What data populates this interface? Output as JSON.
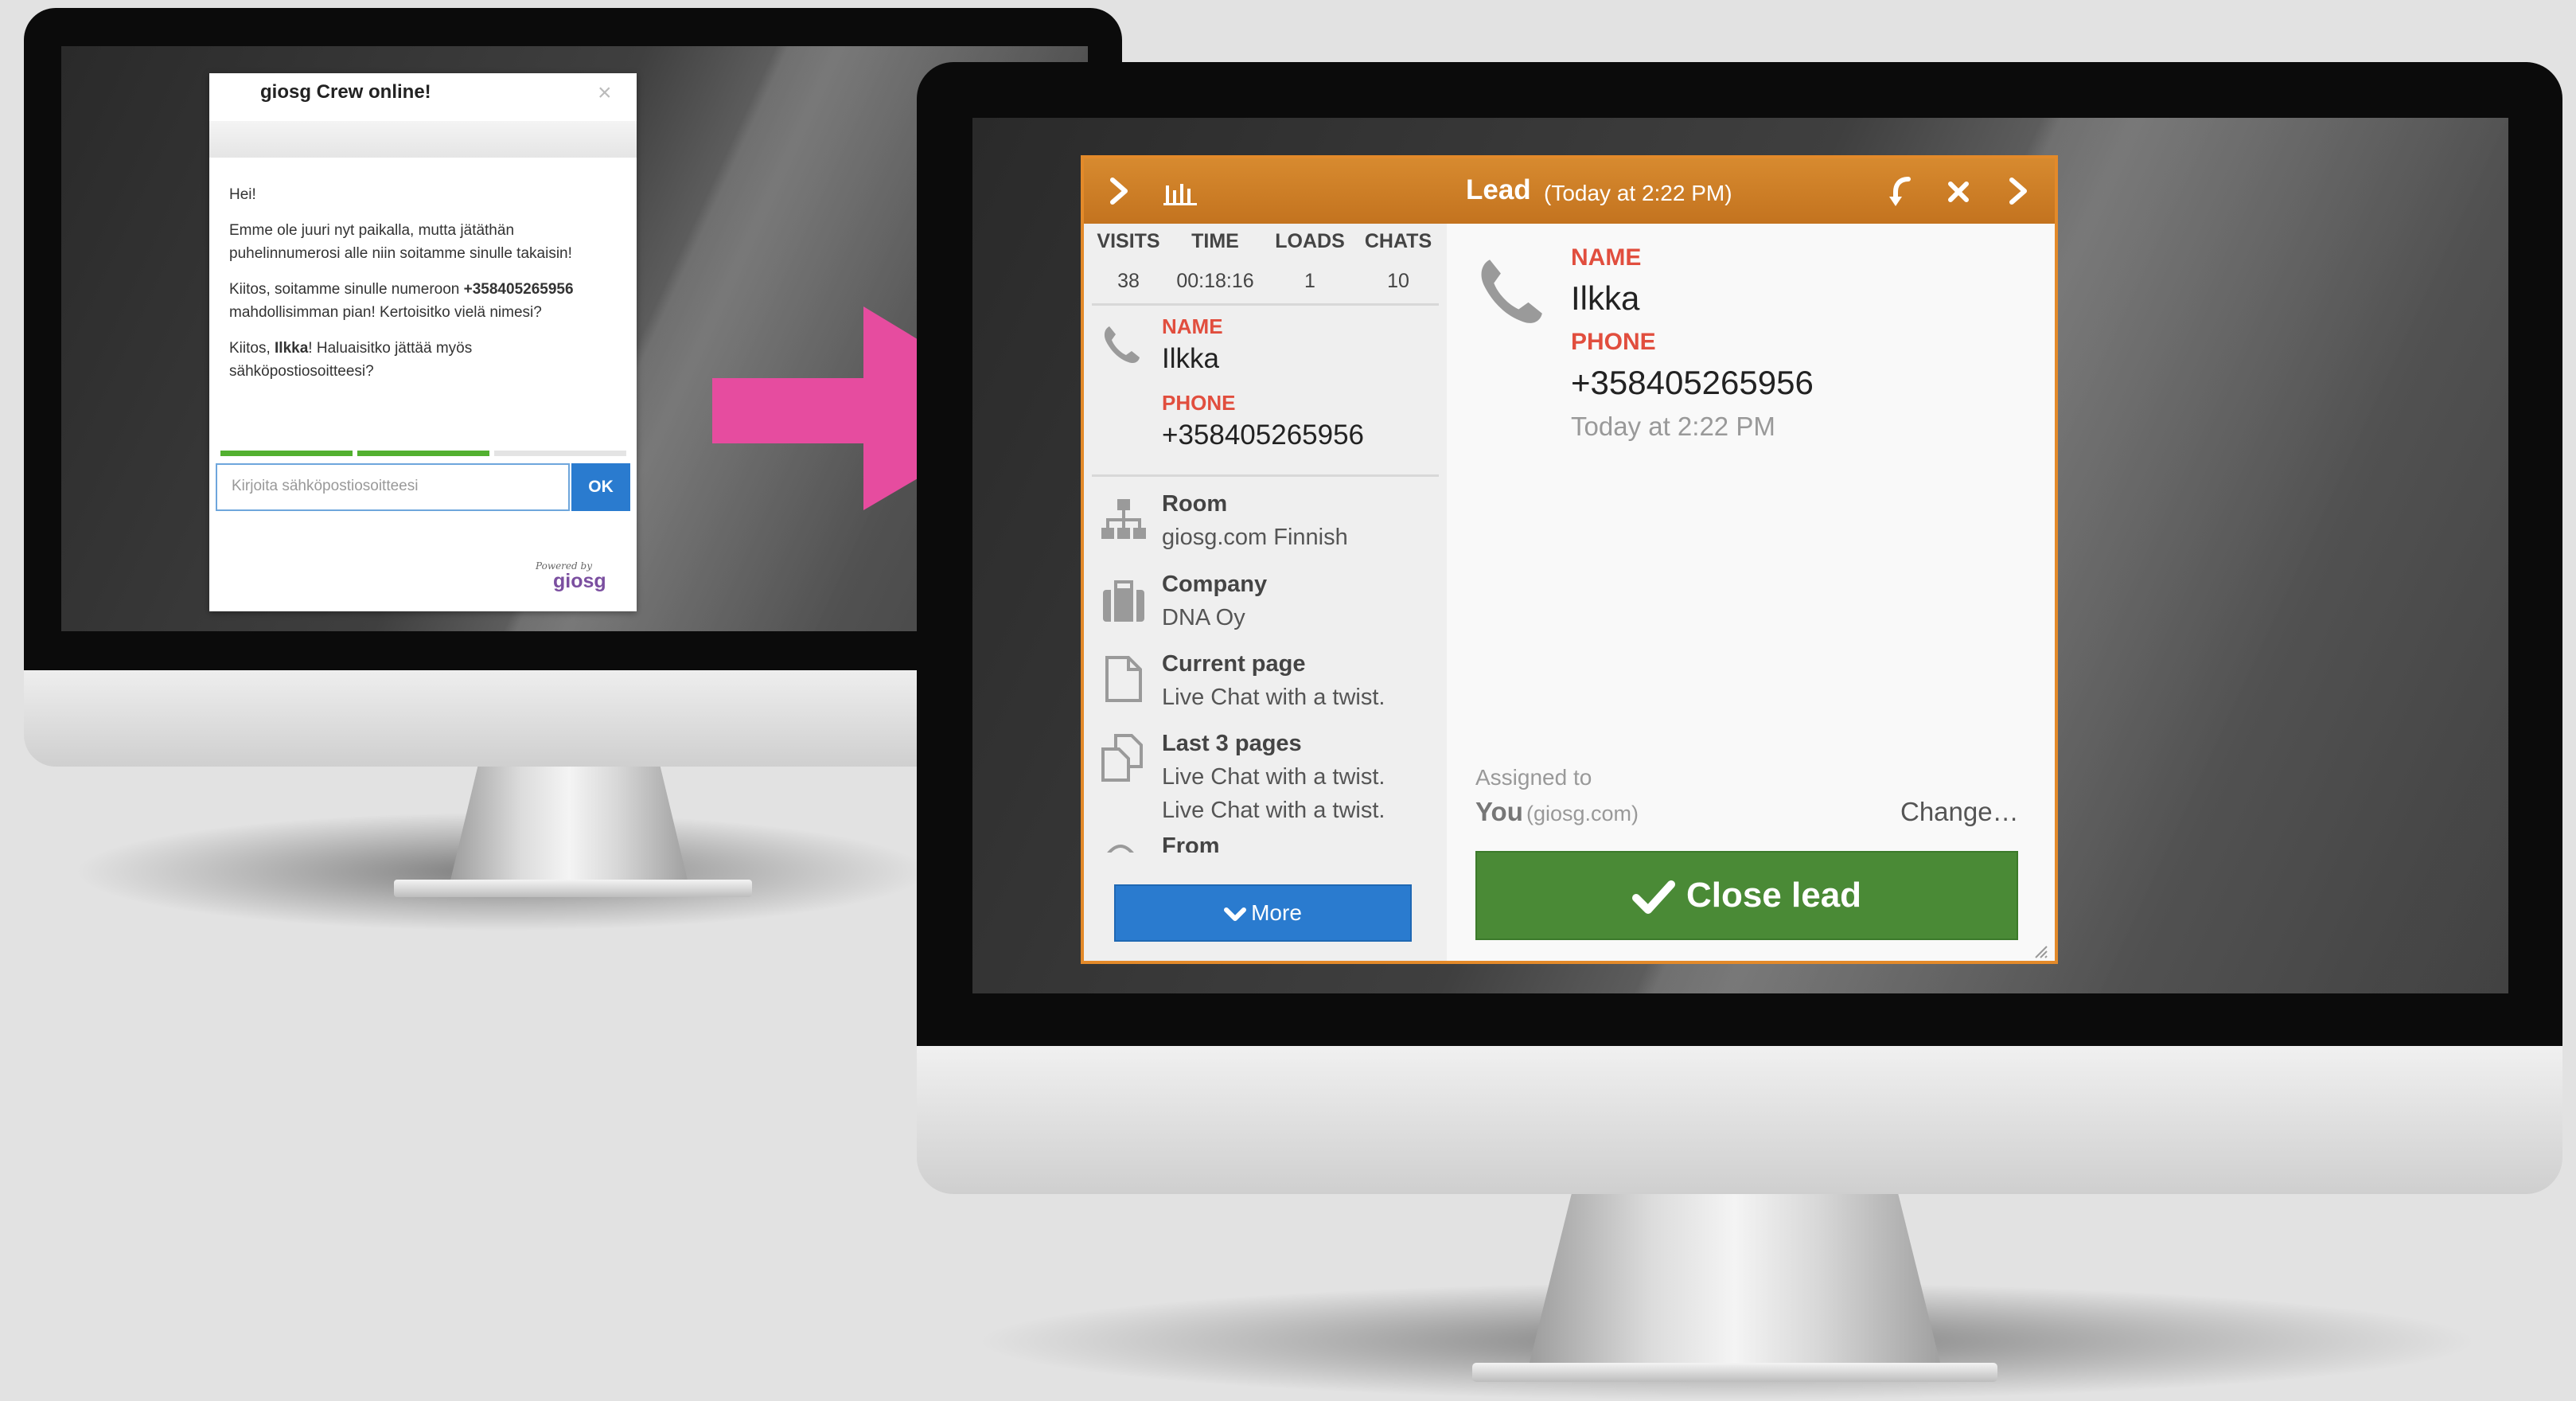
{
  "left_widget": {
    "title": "giosg Crew online!",
    "close_glyph": "×",
    "greeting": "Hei!",
    "msg1": "Emme ole juuri nyt paikalla, mutta jätäthän puhelinnumerosi alle niin soitamme sinulle takaisin!",
    "msg2_pre": "Kiitos, soitamme sinulle numeroon ",
    "msg2_bold": "+358405265956",
    "msg2_post": " mahdollisimman pian! Kertoisitko vielä nimesi?",
    "msg3_pre": "Kiitos, ",
    "msg3_bold": "Ilkka",
    "msg3_post": "! Haluaisitko jättää myös sähköpostiosoitteesi?",
    "input_placeholder": "Kirjoita sähköpostiosoitteesi",
    "ok_label": "OK",
    "progress_steps": 3,
    "progress_done": 2,
    "powered_by": "Powered by",
    "brand": "giosg"
  },
  "lead": {
    "title": "Lead",
    "subtitle": "(Today at 2:22 PM)",
    "stats": {
      "headers": [
        "VISITS",
        "TIME",
        "LOADS",
        "CHATS"
      ],
      "values": [
        "38",
        "00:18:16",
        "1",
        "10"
      ]
    },
    "contact": {
      "name_label": "NAME",
      "name": "Ilkka",
      "phone_label": "PHONE",
      "phone": "+358405265956"
    },
    "info": [
      {
        "title": "Room",
        "lines": [
          "giosg.com Finnish"
        ],
        "icon": "room-icon"
      },
      {
        "title": "Company",
        "lines": [
          "DNA Oy"
        ],
        "icon": "briefcase-icon"
      },
      {
        "title": "Current page",
        "lines": [
          "Live Chat with a twist."
        ],
        "icon": "page-icon"
      },
      {
        "title": "Last 3 pages",
        "lines": [
          "Live Chat with a twist.",
          "Live Chat with a twist."
        ],
        "icon": "pages-icon"
      },
      {
        "title": "From",
        "lines": [],
        "icon": "from-icon"
      }
    ],
    "more_label": "More",
    "detail": {
      "name_label": "NAME",
      "name": "Ilkka",
      "phone_label": "PHONE",
      "phone": "+358405265956",
      "timestamp": "Today at 2:22 PM"
    },
    "assigned_label": "Assigned to",
    "assigned_you": "You",
    "assigned_domain": "(giosg.com)",
    "change_label": "Change…",
    "close_lead_label": "Close lead"
  },
  "colors": {
    "header_orange": "#d07f28",
    "border_orange": "#e38a2a",
    "label_red": "#e14e3e",
    "more_blue": "#2a7bcf",
    "close_green": "#4a8a36",
    "arrow_pink": "#e64c9f",
    "progress_green": "#52b030"
  }
}
